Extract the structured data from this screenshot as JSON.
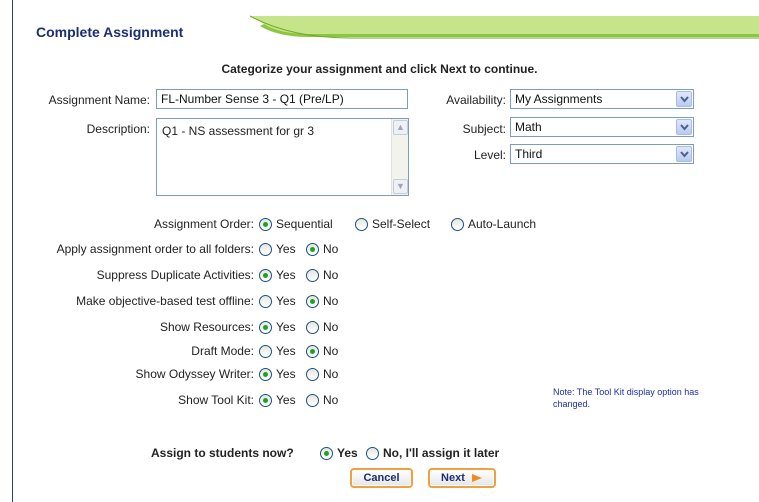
{
  "header": {
    "title": "Complete Assignment"
  },
  "instructions": "Categorize your assignment and click Next to continue.",
  "form": {
    "assignment_name_label": "Assignment Name:",
    "assignment_name_value": "FL-Number Sense 3 - Q1 (Pre/LP)",
    "description_label": "Description:",
    "description_value": "Q1 - NS assessment for gr 3",
    "availability_label": "Availability:",
    "availability_value": "My Assignments",
    "subject_label": "Subject:",
    "subject_value": "Math",
    "level_label": "Level:",
    "level_value": "Third"
  },
  "options": {
    "assignment_order": {
      "label": "Assignment Order:",
      "choices": [
        "Sequential",
        "Self-Select",
        "Auto-Launch"
      ],
      "selected": "Sequential"
    },
    "apply_order": {
      "label": "Apply assignment order to all folders:",
      "choices": [
        "Yes",
        "No"
      ],
      "selected": "No"
    },
    "suppress_duplicates": {
      "label": "Suppress Duplicate Activities:",
      "choices": [
        "Yes",
        "No"
      ],
      "selected": "Yes"
    },
    "objective_offline": {
      "label": "Make objective-based test offline:",
      "choices": [
        "Yes",
        "No"
      ],
      "selected": "No"
    },
    "show_resources": {
      "label": "Show Resources:",
      "choices": [
        "Yes",
        "No"
      ],
      "selected": "Yes"
    },
    "draft_mode": {
      "label": "Draft Mode:",
      "choices": [
        "Yes",
        "No"
      ],
      "selected": "No"
    },
    "show_writer": {
      "label": "Show Odyssey Writer:",
      "choices": [
        "Yes",
        "No"
      ],
      "selected": "Yes"
    },
    "show_toolkit": {
      "label": "Show Tool Kit:",
      "choices": [
        "Yes",
        "No"
      ],
      "selected": "Yes"
    }
  },
  "note": "Note: The Tool Kit display option has changed.",
  "assign": {
    "label": "Assign to students now?",
    "yes": "Yes",
    "no": "No, I'll assign it later",
    "selected": "Yes"
  },
  "buttons": {
    "cancel": "Cancel",
    "next": "Next"
  },
  "colors": {
    "title": "#1c2e74",
    "accent_green": "#9ccd3c",
    "button_border": "#f0a040",
    "radio_dot": "#21a121"
  }
}
